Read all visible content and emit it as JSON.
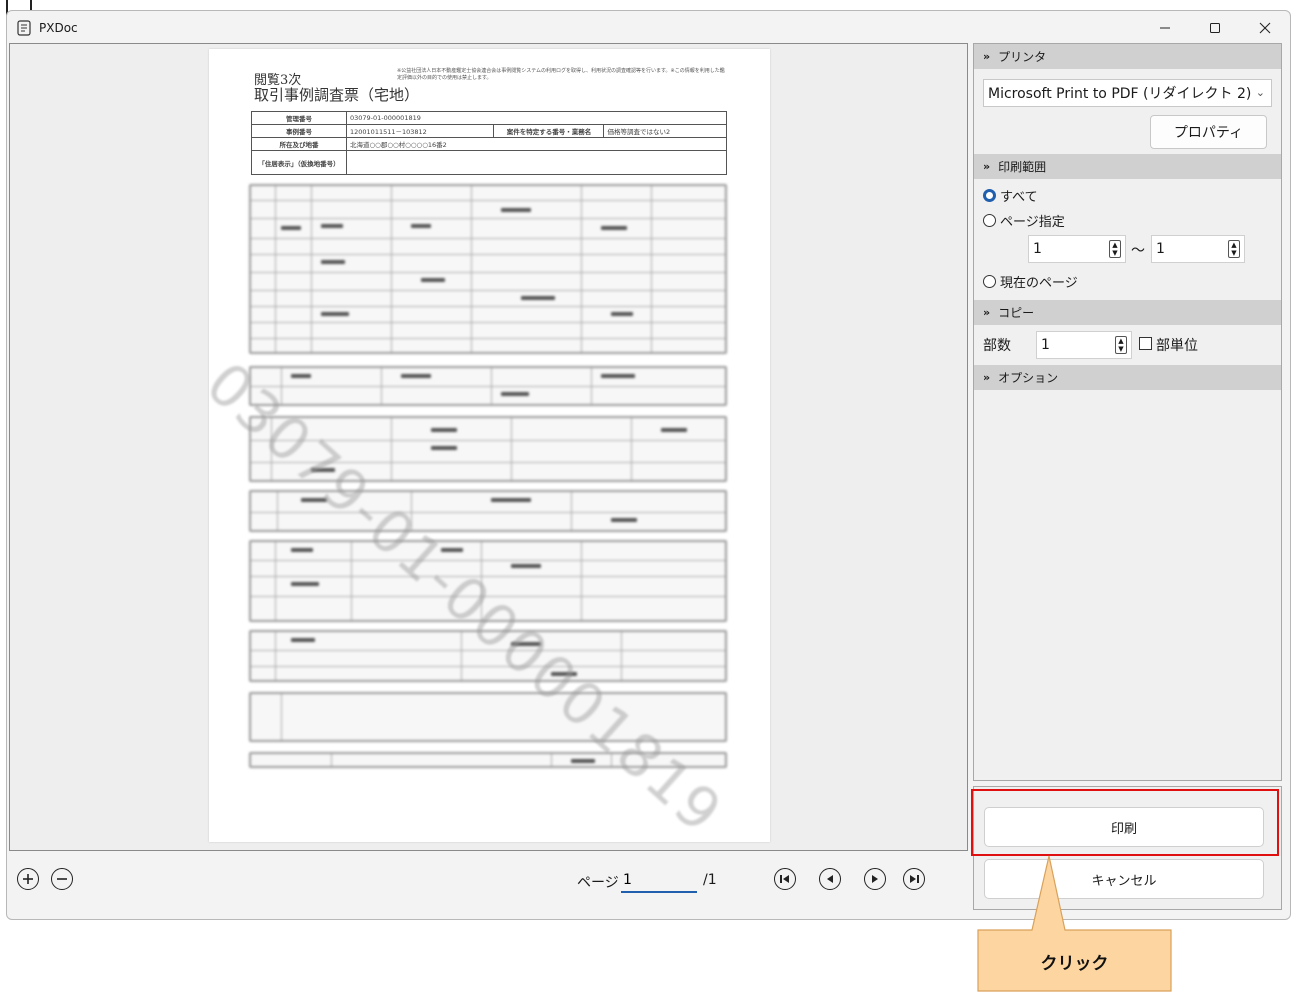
{
  "window": {
    "title": "PXDoc",
    "controls": [
      "minimize",
      "maximize",
      "close"
    ]
  },
  "document": {
    "title_line1": "閲覧3次",
    "title_line2": "取引事例調査票（宅地）",
    "notes": "※公益社団法人日本不動産鑑定士協会連合会は事例閲覧システムの利用ログを取得し、利用状況の調査確認等を行います。※この情報を利用した鑑定評価以外の目的での使用は禁止します。",
    "rows": [
      {
        "label": "管理番号",
        "value": "03079-01-000001819"
      },
      {
        "label": "事例番号",
        "value": "12001011511－103812",
        "extra_label": "案件を特定する番号・業務名",
        "extra_value": "価格等調査ではない2"
      },
      {
        "label": "所在及び地番",
        "value": "北海道○○郡○○村○○○○16番2"
      },
      {
        "label": "「住居表示」（仮換地番号）",
        "value": ""
      }
    ],
    "watermark": "03079-01-000001819"
  },
  "bottombar": {
    "zoom_in_icon": "zoom-in-icon",
    "zoom_out_icon": "zoom-out-icon",
    "page_label": "ページ",
    "page_value": "1",
    "page_total": "/1"
  },
  "side": {
    "printer_section": "プリンタ",
    "printer_selected": "Microsoft Print to PDF (リダイレクト 2)",
    "properties_button": "プロパティ",
    "range_section": "印刷範囲",
    "range_all": "すべて",
    "range_pages": "ページ指定",
    "range_from": "1",
    "range_tilde": "～",
    "range_to": "1",
    "range_current": "現在のページ",
    "copy_section": "コピー",
    "copies_label": "部数",
    "copies_value": "1",
    "collate_label": "部単位",
    "options_section": "オプション"
  },
  "buttons": {
    "print": "印刷",
    "cancel": "キャンセル"
  },
  "callout": {
    "text": "クリック",
    "fill": "#fcd5a0",
    "stroke": "#d9a15a"
  },
  "colors": {
    "accent": "#1f5fae",
    "highlight": "#e01010",
    "section_bg": "#d0d0d0"
  }
}
